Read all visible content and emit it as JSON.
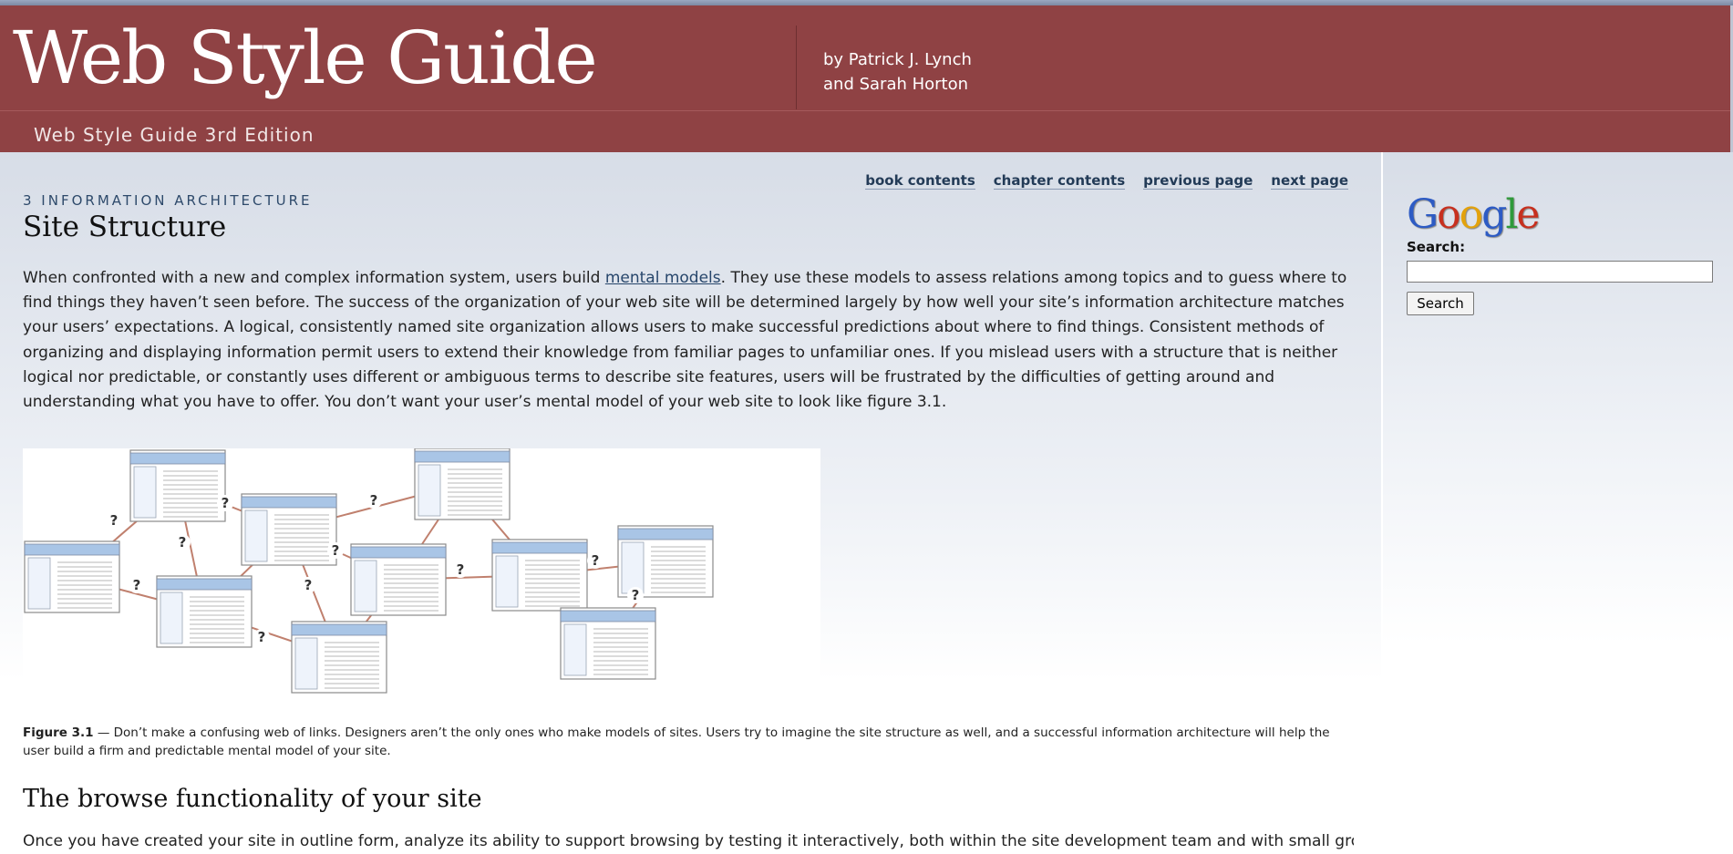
{
  "header": {
    "logo": "Web Style Guide",
    "author_line1": "by Patrick J. Lynch",
    "author_line2": "and Sarah Horton",
    "edition": "Web Style Guide 3rd Edition"
  },
  "nav": {
    "book_contents": "book contents",
    "chapter_contents": "chapter contents",
    "previous_page": "previous page",
    "next_page": "next page"
  },
  "article": {
    "kicker": "3 INFORMATION ARCHITECTURE",
    "title": "Site Structure",
    "p1_before": "When confronted with a new and complex information system, users build ",
    "p1_link": "mental models",
    "p1_after": ". They use these models to assess relations among topics and to guess where to find things they haven’t seen before. The success of the organization of your web site will be determined largely by how well your site’s information architecture matches your users’ expectations. A logical, consistently named site organization allows users to make successful predictions about where to find things. Consistent methods of organizing and displaying information permit users to extend their knowledge from familiar pages to unfamiliar ones. If you mislead users with a structure that is neither logical nor predictable, or constantly uses different or ambiguous terms to describe site features, users will be frustrated by the difficulties of getting around and understanding what you have to offer. You don’t want your user’s mental model of your web site to look like figure 3.1.",
    "figure_mark": "?",
    "caption_label": "Figure 3.1",
    "caption_text": " — Don’t make a confusing web of links. Designers aren’t the only ones who make models of sites. Users try to imagine the site structure as well, and a successful information architecture will help the user build a firm and predictable mental model of your site.",
    "h2": "The browse functionality of your site",
    "p2": "Once you have created your site in outline form, analyze its ability to support browsing by testing it interactively, both within the site development team and with small groups"
  },
  "sidebar": {
    "google_letters": [
      "G",
      "o",
      "o",
      "g",
      "l",
      "e"
    ],
    "search_label": "Search:",
    "search_value": "",
    "search_button": "Search"
  },
  "colors": {
    "header_bg": "#8f4244",
    "link": "#27466b",
    "figure_line": "#c0806e",
    "figure_page_header": "#a9c5e6"
  }
}
